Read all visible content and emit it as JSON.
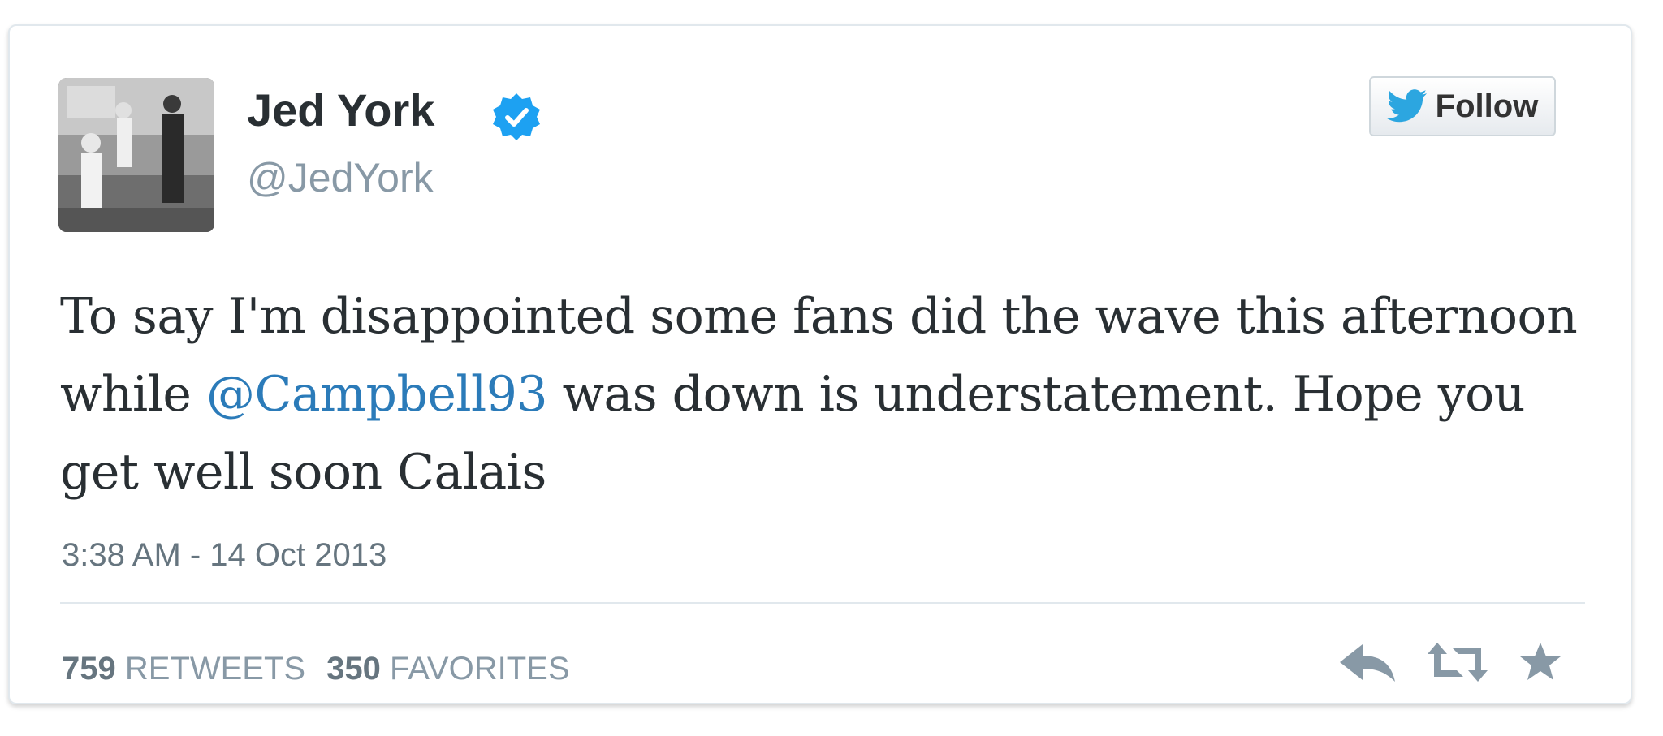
{
  "user": {
    "name": "Jed York",
    "handle": "@JedYork"
  },
  "follow_button": {
    "label": "Follow"
  },
  "tweet": {
    "text_part1": "To say I'm disappointed some fans did the wave this afternoon while ",
    "mention": "@Campbell93",
    "text_part2": " was down is understatement. Hope you get well soon Calais",
    "timestamp": "3:38 AM - 14 Oct 2013"
  },
  "stats": {
    "retweets_count": "759",
    "retweets_label": "RETWEETS",
    "favorites_count": "350",
    "favorites_label": "FAVORITES"
  },
  "actions": {
    "reply_icon": "reply-icon",
    "retweet_icon": "retweet-icon",
    "favorite_icon": "star-icon"
  },
  "colors": {
    "accent": "#2b7bb9",
    "verified": "#1da1f2",
    "text": "#292f33",
    "muted": "#8899a6"
  }
}
